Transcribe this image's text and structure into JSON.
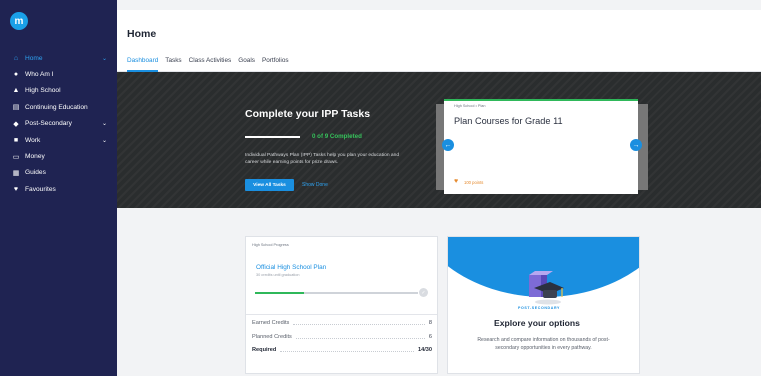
{
  "app": {
    "logo_letter": "m"
  },
  "sidebar": {
    "items": [
      {
        "label": "Home",
        "active": true,
        "has_chevron": true
      },
      {
        "label": "Who Am I",
        "active": false,
        "has_chevron": false
      },
      {
        "label": "High School",
        "active": false,
        "has_chevron": false
      },
      {
        "label": "Continuing Education",
        "active": false,
        "has_chevron": false
      },
      {
        "label": "Post-Secondary",
        "active": false,
        "has_chevron": true
      },
      {
        "label": "Work",
        "active": false,
        "has_chevron": true
      },
      {
        "label": "Money",
        "active": false,
        "has_chevron": false
      },
      {
        "label": "Guides",
        "active": false,
        "has_chevron": false
      },
      {
        "label": "Favourites",
        "active": false,
        "has_chevron": false
      }
    ]
  },
  "header": {
    "title": "Home",
    "tabs": [
      "Dashboard",
      "Tasks",
      "Class Activities",
      "Goals",
      "Portfolios"
    ],
    "active_tab": "Dashboard"
  },
  "ipp": {
    "title": "Complete your IPP Tasks",
    "progress_text": "0 of 9 Completed",
    "progress_fraction": 0,
    "description": "Individual Pathways Plan (IPP) Tasks help you plan your education and career while earning points for prize draws.",
    "view_button": "View All Tasks",
    "show_link": "Show Done"
  },
  "course_card": {
    "eyebrow": "High School • Plan",
    "title": "Plan Courses for Grade 11",
    "credits": "100 points"
  },
  "high_school": {
    "eyebrow": "High School Progress",
    "plan_link": "Official High School Plan",
    "plan_sub": "30 credits until graduation",
    "progress_fraction": 0.3,
    "rows": [
      {
        "label": "Earned Credits",
        "value": "8"
      },
      {
        "label": "Planned Credits",
        "value": "6"
      },
      {
        "label": "Required",
        "value": "14/30"
      }
    ]
  },
  "explore": {
    "eyebrow": "POST-SECONDARY",
    "title": "Explore your options",
    "description": "Research and compare information on thousands of post-secondary opportunities in every pathway."
  },
  "colors": {
    "sidebar": "#1f2352",
    "accent": "#1a8fe0",
    "success": "#2fb85a",
    "hero": "#2a2d2e"
  }
}
